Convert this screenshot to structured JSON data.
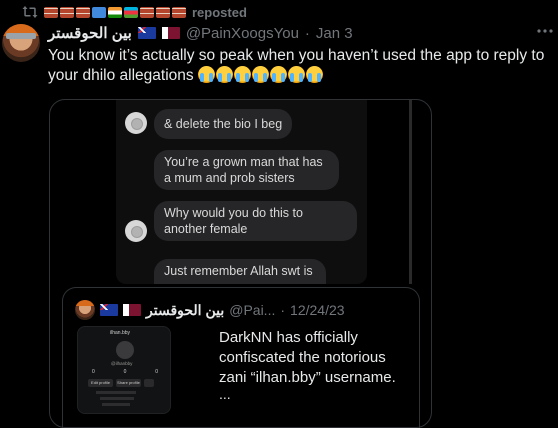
{
  "repost": {
    "label": "reposted",
    "emojis": [
      "brick",
      "brick",
      "brick",
      "somalia-flag",
      "india-flag",
      "azerbaijan-flag",
      "brick",
      "brick",
      "brick"
    ]
  },
  "tweet": {
    "display_name": "بين الحوقستر",
    "handle": "@PainXoogsYou",
    "separator": "·",
    "date": "Jan 3",
    "text": "You know it’s actually so peak when you haven’t used the app to reply to your dhilo allegations",
    "trailing_emoji": "loudly-crying-face",
    "trailing_emoji_count": 7,
    "flags": [
      "australia-flag",
      "qatar-flag"
    ]
  },
  "media": {
    "chat": [
      {
        "text": "& delete the bio I beg",
        "has_avatar": true
      },
      {
        "text": "You’re a grown man that has a mum and prob sisters",
        "has_avatar": false
      },
      {
        "text": "Why would you do this to another female",
        "has_avatar": true
      },
      {
        "text": "Just remember Allah swt is",
        "has_avatar": false
      }
    ]
  },
  "quote": {
    "display_name": "بين الحوقستر",
    "handle": "@Pai...",
    "separator": "·",
    "date": "12/24/23",
    "text": "DarkNN has officially confiscated the notorious zani “ilhan.bby” username.",
    "ellipsis": "...",
    "thumbnail": {
      "username": "ilhan.bby",
      "sub": "@ilhanbby",
      "btn_edit": "Edit profile",
      "btn_share": "Share profile",
      "stats": [
        "0",
        "0",
        "0"
      ]
    }
  },
  "colors": {
    "background": "#000000",
    "text": "#e7e9ea",
    "muted": "#71767b",
    "border": "#2f3336",
    "bubble": "#262628"
  }
}
